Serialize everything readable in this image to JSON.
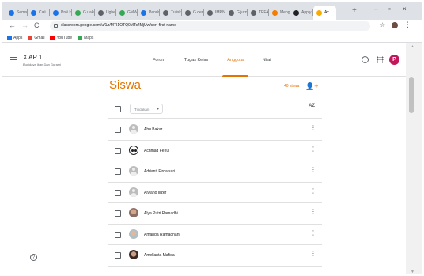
{
  "browser": {
    "tabs": [
      {
        "label": "Sema",
        "color": "#1a73e8"
      },
      {
        "label": "Cali",
        "color": "#1a73e8"
      },
      {
        "label": "Pro\\ k",
        "color": "#1a73e8"
      },
      {
        "label": "G uaknu",
        "color": "#34a853"
      },
      {
        "label": "Ughe",
        "color": "#5f6368"
      },
      {
        "label": "GMW",
        "color": "#34a853"
      },
      {
        "label": "Pendo",
        "color": "#1a73e8"
      },
      {
        "label": "Tulisk",
        "color": "#5f6368"
      },
      {
        "label": "G demo",
        "color": "#5f6368"
      },
      {
        "label": "IMRN",
        "color": "#5f6368"
      },
      {
        "label": "G jurnal",
        "color": "#5f6368"
      },
      {
        "label": "TEFA",
        "color": "#5f6368"
      },
      {
        "label": "Meng",
        "color": "#f57c00"
      },
      {
        "label": "Apply",
        "color": "#202124"
      },
      {
        "label": "Ac",
        "color": "#f9ab00"
      }
    ],
    "new_tab": "+",
    "minimize": "–",
    "maximize": "▫",
    "close": "×",
    "back": "←",
    "forward": "→",
    "reload": "C",
    "url": "classroom.google.com/u/1/r/MTI1OTQ0MTc4MjUw/sort-first-name",
    "bookmark_star": "☆",
    "menu_dots": "⋮",
    "bookmarks": [
      {
        "label": "Apps",
        "color": "#1a73e8"
      },
      {
        "label": "Gmail",
        "color": "#ea4335"
      },
      {
        "label": "YouTube",
        "color": "#ff0000"
      },
      {
        "label": "Maps",
        "color": "#34a853"
      }
    ]
  },
  "appbar": {
    "class_name": "X AP 1",
    "class_subtitle": "Budidaya Ikan Dan Gurami",
    "tabs": [
      {
        "label": "Forum",
        "active": false
      },
      {
        "label": "Tugas Kelas",
        "active": false
      },
      {
        "label": "Anggota",
        "active": true
      },
      {
        "label": "Nilai",
        "active": false
      }
    ],
    "profile_initial": "P",
    "accent_color": "#e37400"
  },
  "roster": {
    "title": "Siswa",
    "count": "40 siswa",
    "invite_icon": "👤+",
    "actions_placeholder": "Tindakan",
    "actions_caret": "▾",
    "sort_icon": "AZ",
    "students": [
      {
        "name": "Abu Bakar",
        "avatar": "generic"
      },
      {
        "name": "Achmad Ferlul",
        "avatar": "panda"
      },
      {
        "name": "Adrianti Firda sari",
        "avatar": "generic"
      },
      {
        "name": "Alviano Illzer",
        "avatar": "generic"
      },
      {
        "name": "Alya Putri Ramadhi",
        "avatar": "photo1"
      },
      {
        "name": "Amanda Ramadhani",
        "avatar": "photo2"
      },
      {
        "name": "Amellanta Mafida",
        "avatar": "photo3"
      }
    ],
    "row_menu": "⋮"
  },
  "help_icon": "?",
  "scroll": {
    "up": "▲",
    "down": "▼"
  }
}
